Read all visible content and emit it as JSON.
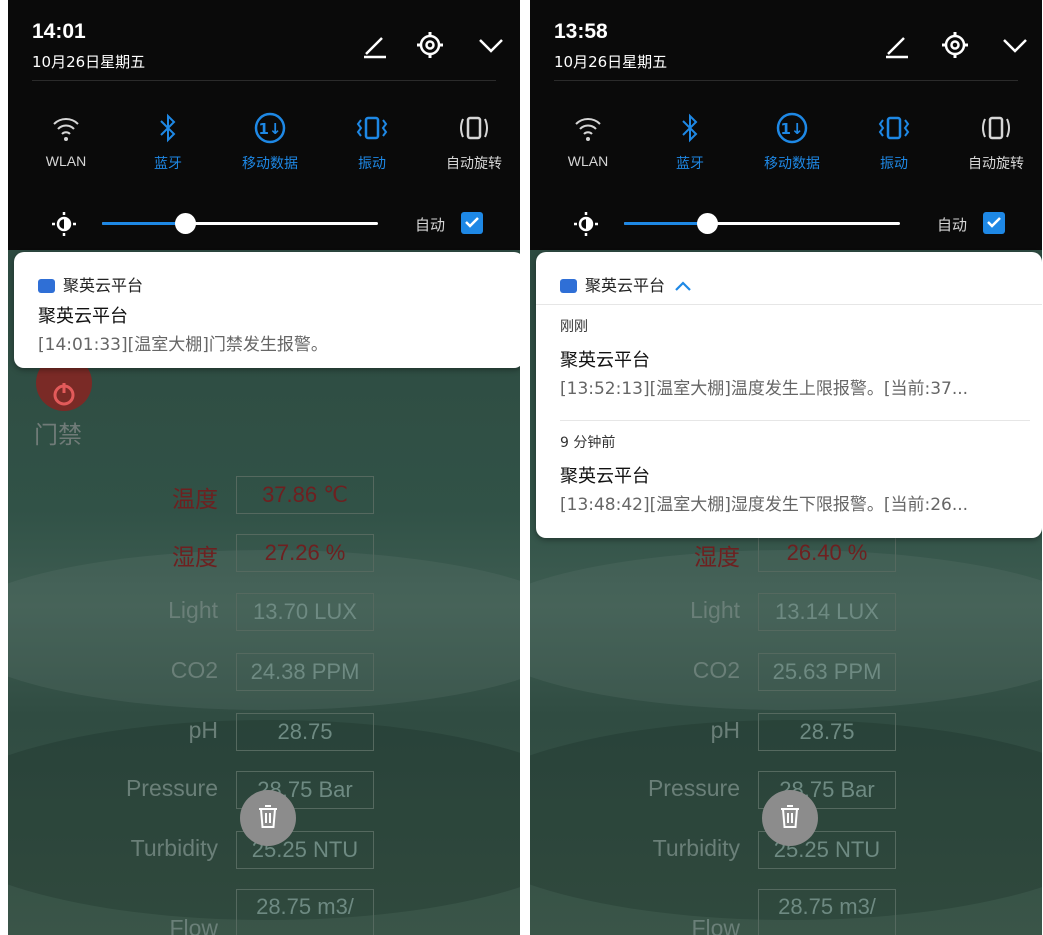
{
  "left": {
    "header": {
      "time": "14:01",
      "date": "10月26日星期五"
    },
    "quick_settings": [
      {
        "label": "WLAN",
        "active": false
      },
      {
        "label": "蓝牙",
        "active": true
      },
      {
        "label": "移动数据",
        "active": true
      },
      {
        "label": "振动",
        "active": true
      },
      {
        "label": "自动旋转",
        "active": false
      }
    ],
    "brightness": {
      "level": 0.3,
      "auto_label": "自动",
      "auto_checked": true
    },
    "notification": {
      "app_name": "聚英云平台",
      "title": "聚英云平台",
      "body": "[14:01:33][温室大棚]门禁发生报警。"
    },
    "app": {
      "gate_label": "门禁",
      "readings": [
        {
          "label": "温度",
          "value": "37.86 ℃",
          "alert": true
        },
        {
          "label": "湿度",
          "value": "27.26 %",
          "alert": true
        },
        {
          "label": "Light",
          "value": "13.70 LUX",
          "alert": false
        },
        {
          "label": "CO2",
          "value": "24.38 PPM",
          "alert": false
        },
        {
          "label": "pH",
          "value": "28.75",
          "alert": false
        },
        {
          "label": "Pressure",
          "value": "28.75 Bar",
          "alert": false
        },
        {
          "label": "Turbidity",
          "value": "25.25 NTU",
          "alert": false
        },
        {
          "label": "Flow",
          "value": "28.75 m3/",
          "alert": false
        }
      ]
    }
  },
  "right": {
    "header": {
      "time": "13:58",
      "date": "10月26日星期五"
    },
    "quick_settings": [
      {
        "label": "WLAN",
        "active": false
      },
      {
        "label": "蓝牙",
        "active": true
      },
      {
        "label": "移动数据",
        "active": true
      },
      {
        "label": "振动",
        "active": true
      },
      {
        "label": "自动旋转",
        "active": false
      }
    ],
    "brightness": {
      "level": 0.3,
      "auto_label": "自动",
      "auto_checked": true
    },
    "notification": {
      "app_name": "聚英云平台",
      "items": [
        {
          "time_ago": "刚刚",
          "title": "聚英云平台",
          "body": "[13:52:13][温室大棚]温度发生上限报警。[当前:37..."
        },
        {
          "time_ago": "9 分钟前",
          "title": "聚英云平台",
          "body": "[13:48:42][温室大棚]湿度发生下限报警。[当前:26..."
        }
      ]
    },
    "app": {
      "readings": [
        {
          "label": "湿度",
          "value": "26.40 %",
          "alert": true
        },
        {
          "label": "Light",
          "value": "13.14 LUX",
          "alert": false
        },
        {
          "label": "CO2",
          "value": "25.63 PPM",
          "alert": false
        },
        {
          "label": "pH",
          "value": "28.75",
          "alert": false
        },
        {
          "label": "Pressure",
          "value": "28.75 Bar",
          "alert": false
        },
        {
          "label": "Turbidity",
          "value": "25.25 NTU",
          "alert": false
        },
        {
          "label": "Flow",
          "value": "28.75 m3/",
          "alert": false
        }
      ]
    }
  },
  "colors": {
    "accent": "#1e88e5",
    "alert_text": "#6e2020"
  }
}
